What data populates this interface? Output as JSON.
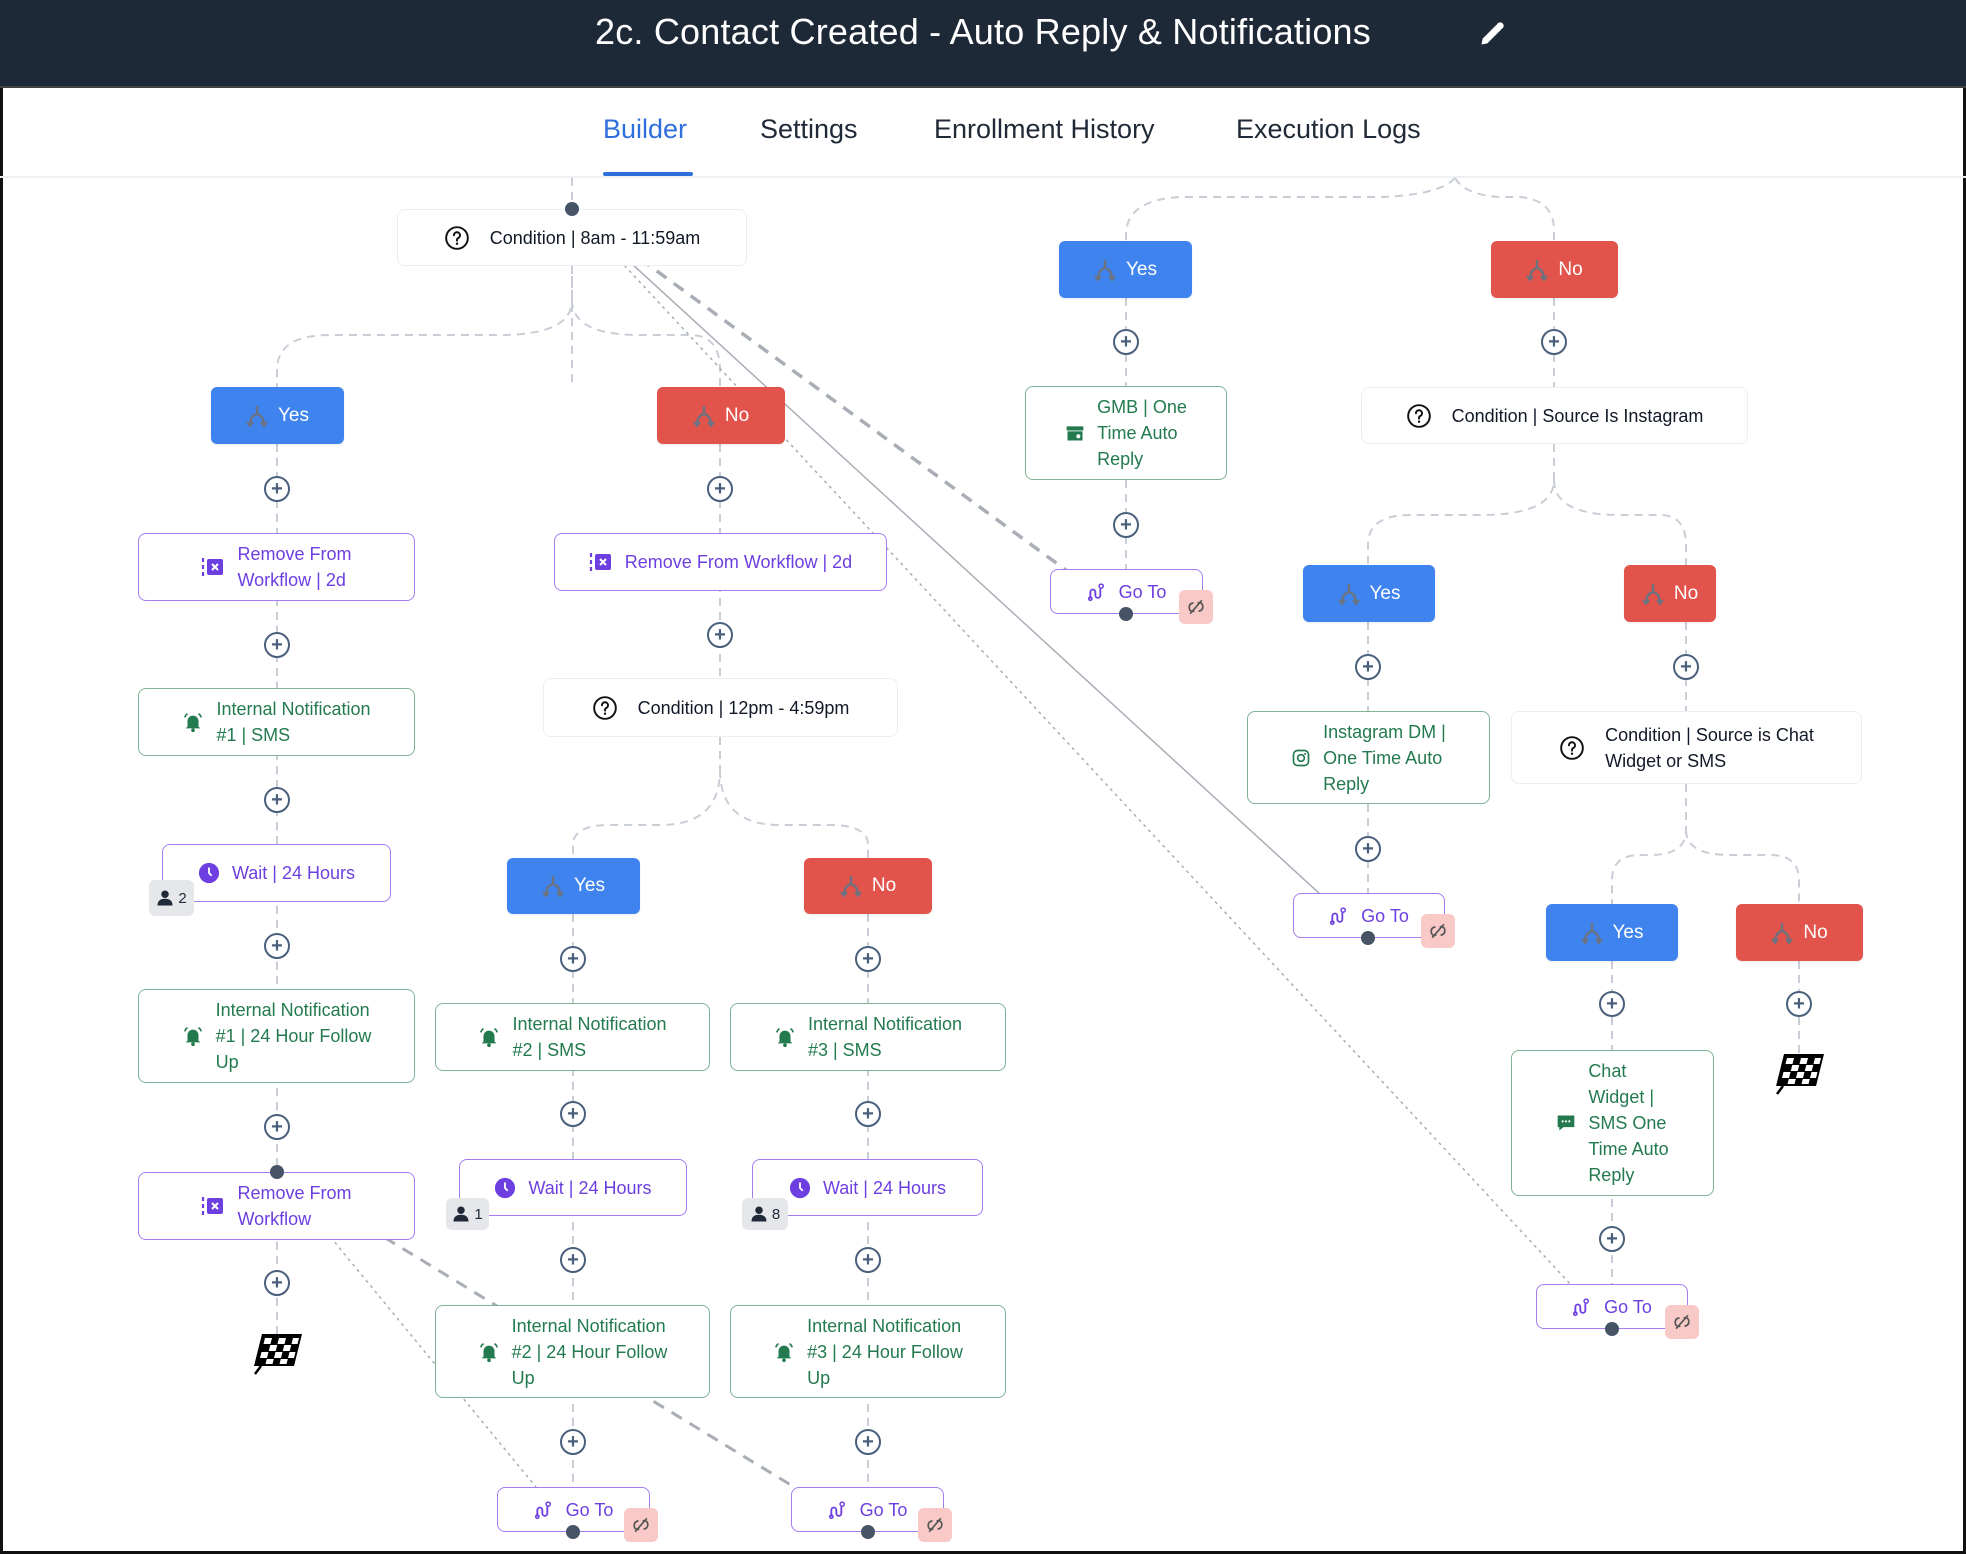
{
  "header": {
    "title": "2c. Contact Created - Auto Reply & Notifications",
    "edit_icon": "pencil-icon"
  },
  "tabs": [
    {
      "label": "Builder",
      "active": true
    },
    {
      "label": "Settings",
      "active": false
    },
    {
      "label": "Enrollment History",
      "active": false
    },
    {
      "label": "Execution Logs",
      "active": false
    }
  ],
  "colors": {
    "header_bg": "#1e2937",
    "active_tab": "#2f6fdb",
    "yes_branch": "#3f84ee",
    "no_branch": "#e2534b",
    "action_purple": "#6d3fe0",
    "action_green": "#237a4e"
  },
  "branches": {
    "yes": "Yes",
    "no": "No"
  },
  "nodes": {
    "cond_morning": "Condition | 8am - 11:59am",
    "remove_left_2d": [
      "Remove From",
      "Workflow | 2d"
    ],
    "notif1_sms": [
      "Internal Notification",
      "#1 | SMS"
    ],
    "wait_left": "Wait | 24 Hours",
    "wait_left_count": "2",
    "notif1_followup": [
      "Internal Notification",
      "#1 | 24 Hour Follow",
      "Up"
    ],
    "remove_left": [
      "Remove From",
      "Workflow"
    ],
    "remove_mid_2d": "Remove From Workflow | 2d",
    "cond_afternoon": "Condition | 12pm - 4:59pm",
    "notif2_sms": [
      "Internal Notification",
      "#2 | SMS"
    ],
    "notif3_sms": [
      "Internal Notification",
      "#3 | SMS"
    ],
    "wait_mid1": "Wait | 24 Hours",
    "wait_mid1_count": "1",
    "wait_mid2": "Wait | 24 Hours",
    "wait_mid2_count": "8",
    "notif2_followup": [
      "Internal Notification",
      "#2 | 24 Hour Follow",
      "Up"
    ],
    "notif3_followup": [
      "Internal Notification",
      "#3 | 24 Hour Follow",
      "Up"
    ],
    "goto": "Go To",
    "gmb_reply": [
      "GMB | One",
      "Time Auto",
      "Reply"
    ],
    "cond_instagram": "Condition | Source Is Instagram",
    "instagram_reply": [
      "Instagram DM |",
      "One Time Auto",
      "Reply"
    ],
    "cond_chat": [
      "Condition | Source is Chat",
      "Widget or SMS"
    ],
    "chat_reply": [
      "Chat",
      "Widget |",
      "SMS One",
      "Time Auto",
      "Reply"
    ]
  }
}
